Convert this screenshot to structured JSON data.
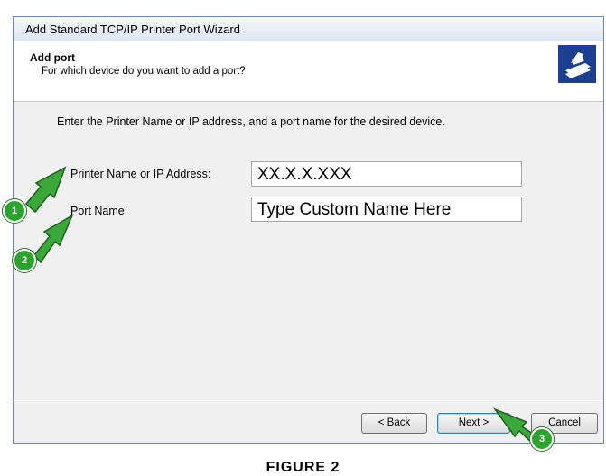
{
  "window": {
    "title": "Add Standard TCP/IP Printer Port Wizard"
  },
  "header": {
    "title": "Add port",
    "subtitle": "For which device do you want to add a port?",
    "icon": "printer-port-icon"
  },
  "body": {
    "instructions": "Enter the Printer Name or IP address, and a port name for the desired device.",
    "fields": [
      {
        "label": "Printer Name or IP Address:",
        "value": "XX.X.X.XXX"
      },
      {
        "label": "Port Name:",
        "value": "Type Custom Name Here"
      }
    ]
  },
  "buttons": {
    "back": "< Back",
    "next": "Next >",
    "cancel": "Cancel"
  },
  "callouts": {
    "one": "1",
    "two": "2",
    "three": "3",
    "color": "#2ea22e"
  },
  "caption": "FIGURE 2"
}
